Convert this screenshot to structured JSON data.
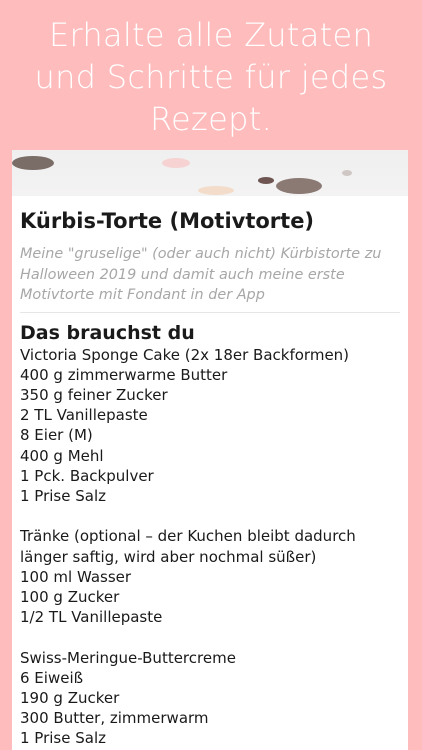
{
  "headline": {
    "line1": "Erhalte alle Zutaten",
    "line2": "und Schritte für jedes",
    "line3": "Rezept."
  },
  "recipe": {
    "title": "Kürbis-Torte (Motivtorte)",
    "description": [
      "Meine \"gruselige\" (oder auch nicht) Kürbistorte zu",
      "Halloween 2019 und damit auch meine erste",
      "Motivtorte mit Fondant in der App"
    ],
    "section_title": "Das brauchst du",
    "ingredients": [
      "Victoria Sponge Cake (2x 18er Backformen)",
      "400 g zimmerwarme Butter",
      "350 g feiner Zucker",
      "2 TL Vanillepaste",
      "8 Eier (M)",
      "400 g Mehl",
      "1 Pck. Backpulver",
      "1 Prise Salz",
      "",
      "Tränke (optional – der Kuchen bleibt dadurch",
      "länger saftig, wird aber nochmal süßer)",
      "100 ml Wasser",
      "100 g Zucker",
      "1/2 TL Vanillepaste",
      "",
      "Swiss-Meringue-Buttercreme",
      "6 Eiweiß",
      "190 g Zucker",
      "300 Butter, zimmerwarm",
      "1 Prise Salz"
    ]
  },
  "colors": {
    "background": "#ffbcbd",
    "card": "#ffffff",
    "text": "#1a1a1a",
    "muted": "#a7a7a7"
  }
}
